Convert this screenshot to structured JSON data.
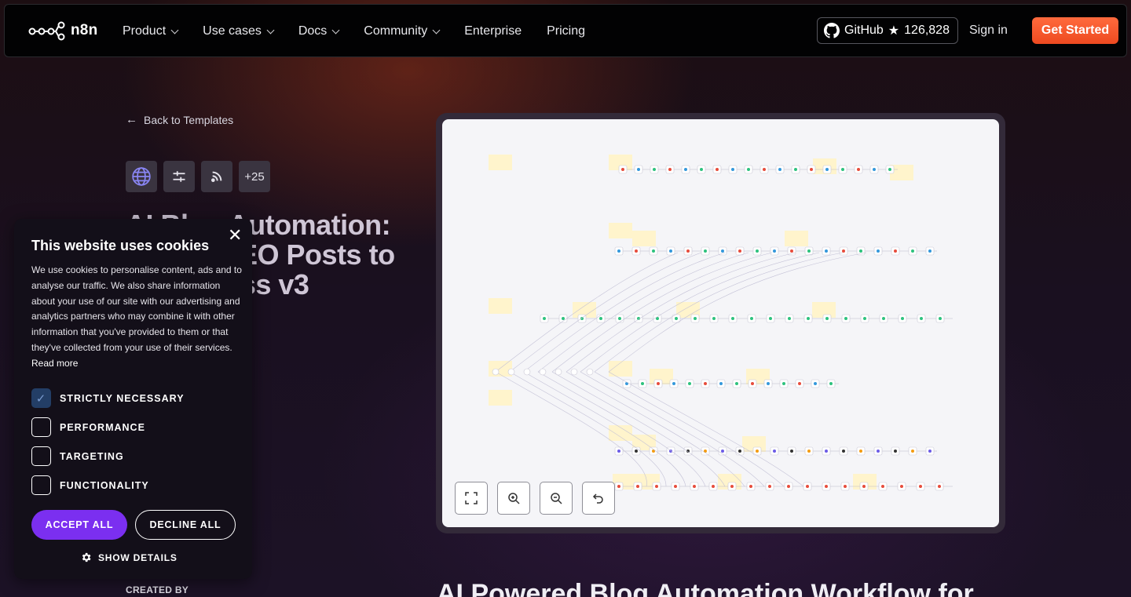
{
  "nav": {
    "logo_text": "n8n",
    "items": [
      {
        "label": "Product",
        "dropdown": true
      },
      {
        "label": "Use cases",
        "dropdown": true
      },
      {
        "label": "Docs",
        "dropdown": true
      },
      {
        "label": "Community",
        "dropdown": true
      },
      {
        "label": "Enterprise",
        "dropdown": false
      },
      {
        "label": "Pricing",
        "dropdown": false
      }
    ],
    "github_label": "GitHub",
    "github_star": "★",
    "github_stars": "126,828",
    "signin": "Sign in",
    "get_started": "Get Started",
    "accent": "#ee4a20"
  },
  "template": {
    "back_label": "Back to Templates",
    "node_icons": [
      "globe-icon",
      "sliders-icon",
      "rss-icon"
    ],
    "more_count": "+25",
    "title": "AI Blog Automation: Hourly SEO Posts to WordPress v3",
    "created_by_label": "CREATED BY",
    "description_title": "AI Powered Blog Automation Workflow for"
  },
  "preview": {
    "controls": [
      "fit-view-icon",
      "zoom-in-icon",
      "zoom-out-icon",
      "reset-icon"
    ]
  },
  "cookie": {
    "title": "This website uses cookies",
    "text": "We use cookies to personalise content, ads and to analyse our traffic. We also share information about your use of our site with our advertising and analytics partners who may combine it with other information that you've provided to them or that they've collected from your use of their services.",
    "read_more": "Read more",
    "options": [
      {
        "label": "STRICTLY NECESSARY",
        "checked": true
      },
      {
        "label": "PERFORMANCE",
        "checked": false
      },
      {
        "label": "TARGETING",
        "checked": false
      },
      {
        "label": "FUNCTIONALITY",
        "checked": false
      }
    ],
    "accept": "ACCEPT ALL",
    "decline": "DECLINE ALL",
    "show_details": "SHOW DETAILS",
    "accept_color": "#7b2ff0"
  }
}
